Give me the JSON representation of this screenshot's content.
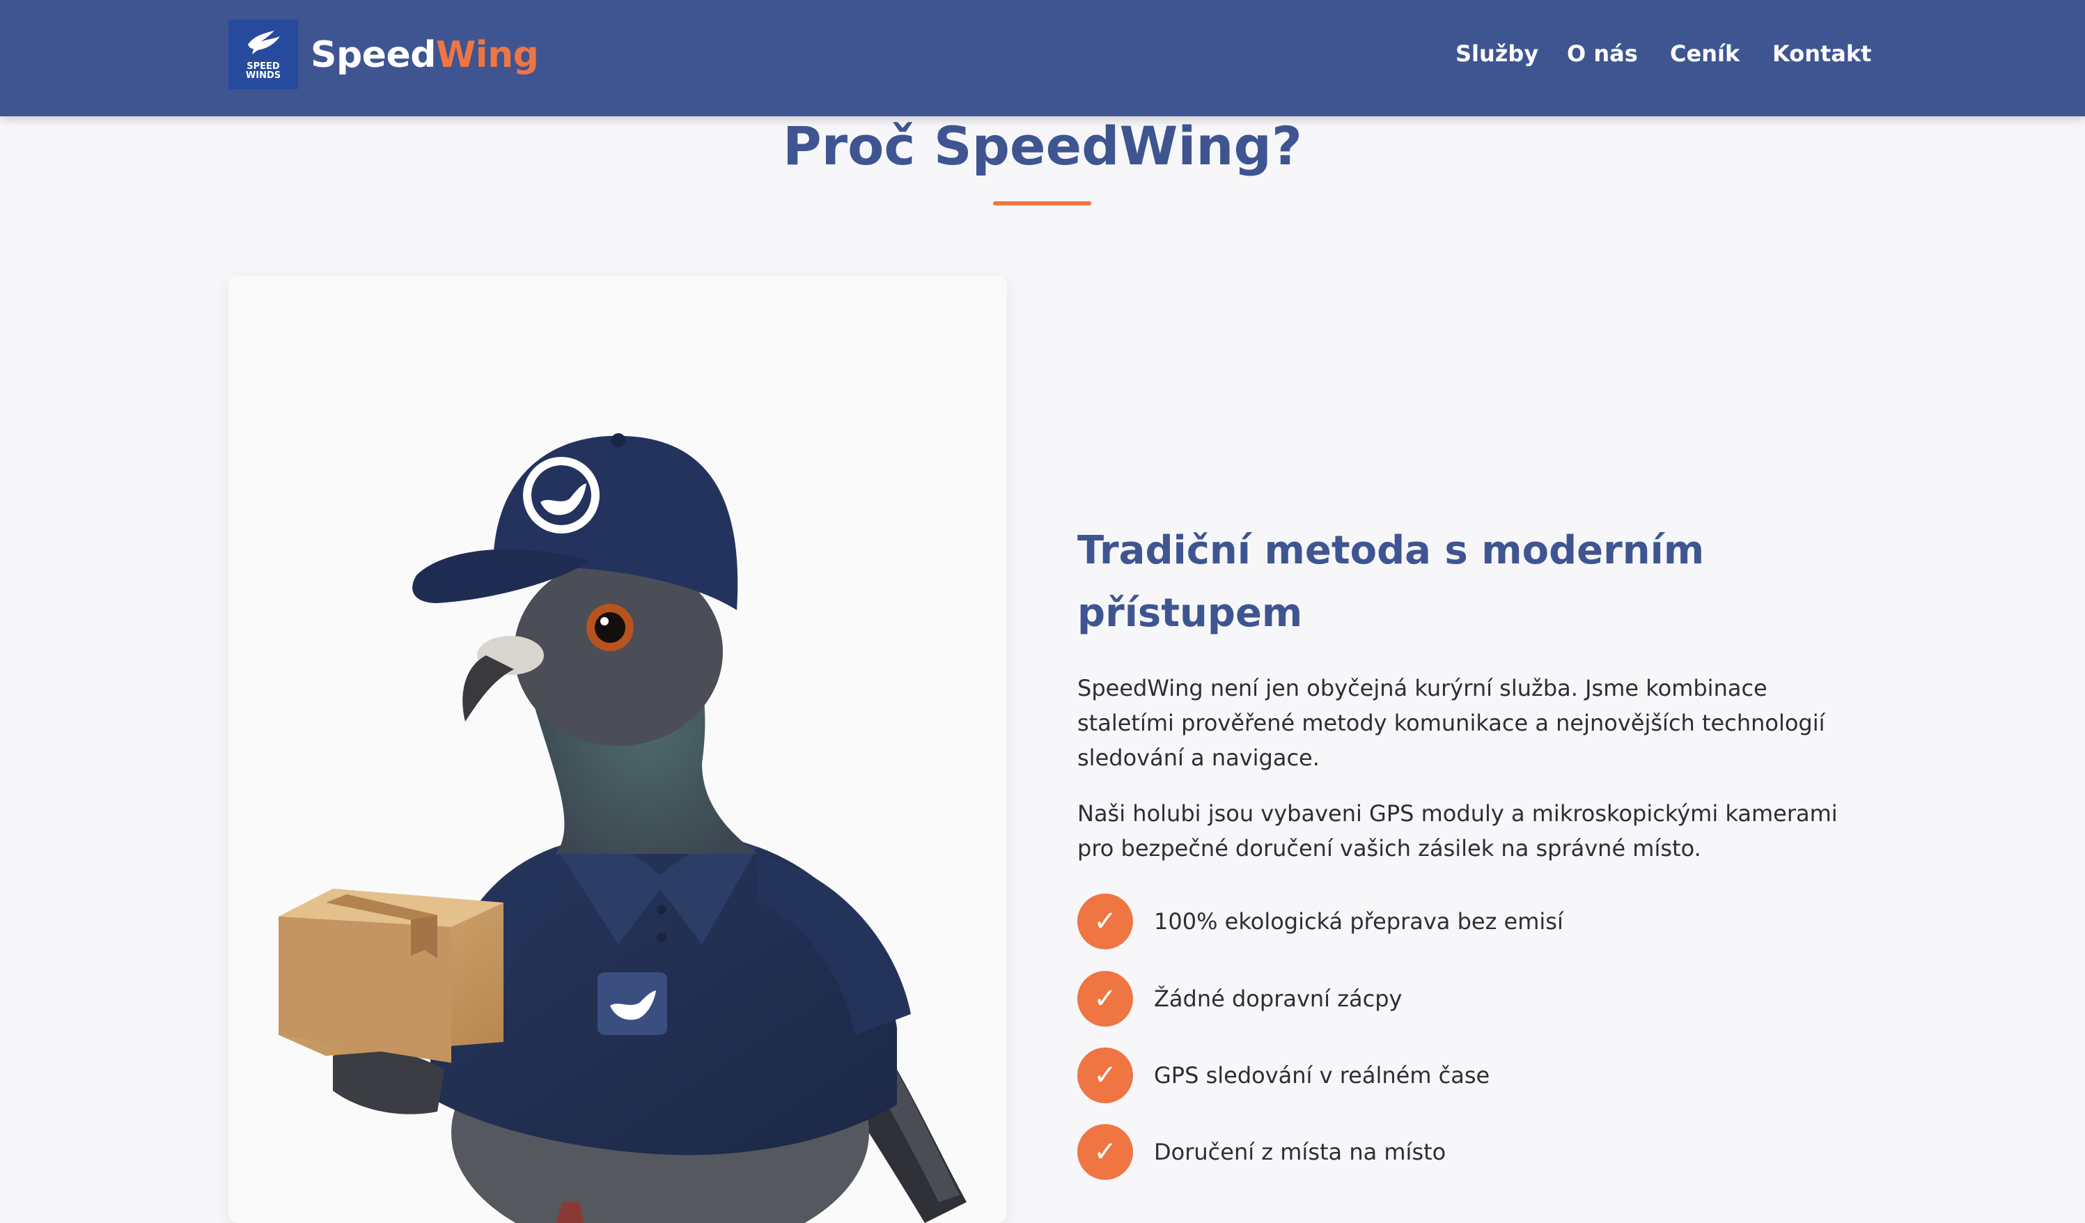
{
  "header": {
    "logo_line1": "SPEED",
    "logo_line2": "WINDS",
    "brand_part1": "Speed",
    "brand_part2": "Wing",
    "nav": [
      "Služby",
      "O nás",
      "Ceník",
      "Kontakt"
    ]
  },
  "section": {
    "title": "Proč SpeedWing?"
  },
  "content": {
    "subtitle": "Tradiční metoda s moderním přístupem",
    "paragraph1": "SpeedWing není jen obyčejná kurýrní služba. Jsme kombinace staletími prověřené metody komunikace a nejnovějších technologií sledování a navigace.",
    "paragraph2": "Naši holubi jsou vybaveni GPS moduly a mikroskopickými kamerami pro bezpečné doručení vašich zásilek na správné místo.",
    "features": [
      "100% ekologická přeprava bez emisí",
      "Žádné dopravní zácpy",
      "GPS sledování v reálném čase",
      "Doručení z místa na místo"
    ],
    "check_glyph": "✓"
  },
  "colors": {
    "header_bg": "#3e5592",
    "accent": "#ef7543",
    "title": "#3e5592",
    "body_text": "#2d2d33",
    "page_bg": "#f7f7f9"
  },
  "icons": {
    "logo": "bird-wing-logo-icon",
    "feature": "check-icon"
  }
}
